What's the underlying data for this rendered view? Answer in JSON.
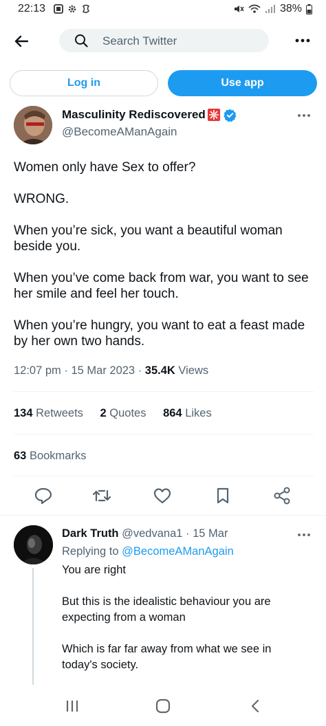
{
  "status_bar": {
    "time": "22:13",
    "battery": "38%"
  },
  "search": {
    "placeholder": "Search Twitter"
  },
  "auth": {
    "login": "Log in",
    "use_app": "Use app"
  },
  "tweet": {
    "author_name": "Masculinity Rediscovered",
    "author_handle": "@BecomeAManAgain",
    "paragraphs": [
      "Women only have Sex to offer?",
      "WRONG.",
      "When you’re sick, you want a beautiful woman beside you.",
      "When you’ve come back from war, you want to see her smile and feel her touch.",
      "When you’re hungry, you want to eat a feast made by her own two hands."
    ],
    "time": "12:07 pm",
    "date": "15 Mar 2023",
    "views_count": "35.4K",
    "views_label": "Views",
    "retweets_count": "134",
    "retweets_label": "Retweets",
    "quotes_count": "2",
    "quotes_label": "Quotes",
    "likes_count": "864",
    "likes_label": "Likes",
    "bookmarks_count": "63",
    "bookmarks_label": "Bookmarks"
  },
  "reply": {
    "author_name": "Dark Truth",
    "author_handle": "@vedvana1",
    "date": "15 Mar",
    "replying_prefix": "Replying to",
    "replying_to": "@BecomeAManAgain",
    "paragraphs": [
      "You are right",
      "But this is the idealistic behaviour you are expecting from a woman",
      "Which is far far away from what we see in today's society."
    ]
  },
  "colors": {
    "accent": "#1d9bf0",
    "text": "#0f1419",
    "secondary": "#536471",
    "divider": "#eff3f4",
    "verified": "#1d9bf0"
  }
}
